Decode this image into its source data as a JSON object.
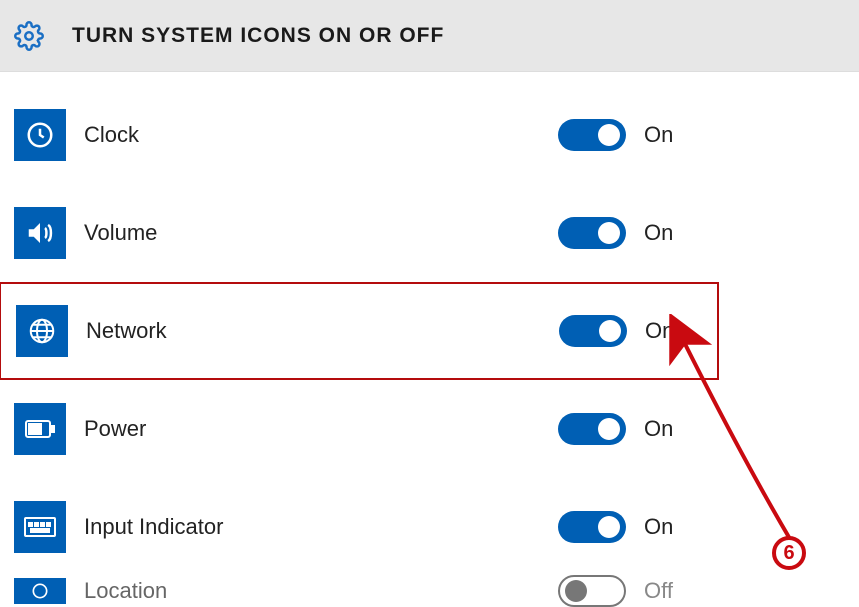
{
  "header": {
    "title": "TURN SYSTEM ICONS ON OR OFF"
  },
  "items": [
    {
      "icon": "clock",
      "label": "Clock",
      "state": "On",
      "on": true
    },
    {
      "icon": "volume",
      "label": "Volume",
      "state": "On",
      "on": true
    },
    {
      "icon": "network",
      "label": "Network",
      "state": "On",
      "on": true,
      "highlight": true
    },
    {
      "icon": "power",
      "label": "Power",
      "state": "On",
      "on": true
    },
    {
      "icon": "input",
      "label": "Input Indicator",
      "state": "On",
      "on": true
    },
    {
      "icon": "location",
      "label": "Location",
      "state": "Off",
      "on": false
    }
  ],
  "annotation": {
    "step": "6"
  }
}
